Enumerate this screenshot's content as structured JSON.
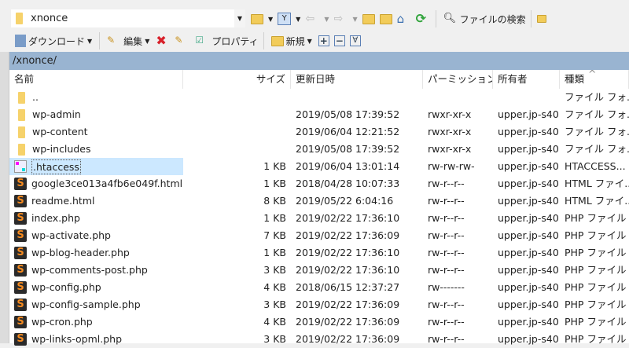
{
  "toolbar": {
    "location": "xnonce",
    "download": "ダウンロード",
    "edit": "編集",
    "properties": "プロパティ",
    "new": "新規",
    "find_files": "ファイルの検索"
  },
  "path": "/xnonce/",
  "columns": [
    "名前",
    "サイズ",
    "更新日時",
    "パーミッション",
    "所有者",
    "種類"
  ],
  "sort_indicator": "^",
  "files": [
    {
      "name": "..",
      "size": "",
      "date": "",
      "perm": "",
      "owner": "",
      "type": "ファイル フォ...",
      "icon": "parent"
    },
    {
      "name": "wp-admin",
      "size": "",
      "date": "2019/05/08 17:39:52",
      "perm": "rwxr-xr-x",
      "owner": "upper.jp-s40",
      "type": "ファイル フォ...",
      "icon": "folder"
    },
    {
      "name": "wp-content",
      "size": "",
      "date": "2019/06/04 12:21:52",
      "perm": "rwxr-xr-x",
      "owner": "upper.jp-s40",
      "type": "ファイル フォ...",
      "icon": "folder"
    },
    {
      "name": "wp-includes",
      "size": "",
      "date": "2019/05/08 17:39:52",
      "perm": "rwxr-xr-x",
      "owner": "upper.jp-s40",
      "type": "ファイル フォ...",
      "icon": "folder"
    },
    {
      "name": ".htaccess",
      "size": "1 KB",
      "date": "2019/06/04 13:01:14",
      "perm": "rw-rw-rw-",
      "owner": "upper.jp-s40",
      "type": "HTACCESS...",
      "icon": "htaccess",
      "selected": true
    },
    {
      "name": "google3ce013a4fb6e049f.html",
      "size": "1 KB",
      "date": "2018/04/28 10:07:33",
      "perm": "rw-r--r--",
      "owner": "upper.jp-s40",
      "type": "HTML ファイ...",
      "icon": "sublime"
    },
    {
      "name": "readme.html",
      "size": "8 KB",
      "date": "2019/05/22 6:04:16",
      "perm": "rw-r--r--",
      "owner": "upper.jp-s40",
      "type": "HTML ファイ...",
      "icon": "sublime"
    },
    {
      "name": "index.php",
      "size": "1 KB",
      "date": "2019/02/22 17:36:10",
      "perm": "rw-r--r--",
      "owner": "upper.jp-s40",
      "type": "PHP ファイル",
      "icon": "sublime"
    },
    {
      "name": "wp-activate.php",
      "size": "7 KB",
      "date": "2019/02/22 17:36:09",
      "perm": "rw-r--r--",
      "owner": "upper.jp-s40",
      "type": "PHP ファイル",
      "icon": "sublime"
    },
    {
      "name": "wp-blog-header.php",
      "size": "1 KB",
      "date": "2019/02/22 17:36:10",
      "perm": "rw-r--r--",
      "owner": "upper.jp-s40",
      "type": "PHP ファイル",
      "icon": "sublime"
    },
    {
      "name": "wp-comments-post.php",
      "size": "3 KB",
      "date": "2019/02/22 17:36:10",
      "perm": "rw-r--r--",
      "owner": "upper.jp-s40",
      "type": "PHP ファイル",
      "icon": "sublime"
    },
    {
      "name": "wp-config.php",
      "size": "4 KB",
      "date": "2018/06/15 12:37:27",
      "perm": "rw-------",
      "owner": "upper.jp-s40",
      "type": "PHP ファイル",
      "icon": "sublime"
    },
    {
      "name": "wp-config-sample.php",
      "size": "3 KB",
      "date": "2019/02/22 17:36:09",
      "perm": "rw-r--r--",
      "owner": "upper.jp-s40",
      "type": "PHP ファイル",
      "icon": "sublime"
    },
    {
      "name": "wp-cron.php",
      "size": "4 KB",
      "date": "2019/02/22 17:36:09",
      "perm": "rw-r--r--",
      "owner": "upper.jp-s40",
      "type": "PHP ファイル",
      "icon": "sublime"
    },
    {
      "name": "wp-links-opml.php",
      "size": "3 KB",
      "date": "2019/02/22 17:36:09",
      "perm": "rw-r--r--",
      "owner": "upper.jp-s40",
      "type": "PHP ファイル",
      "icon": "sublime"
    }
  ]
}
